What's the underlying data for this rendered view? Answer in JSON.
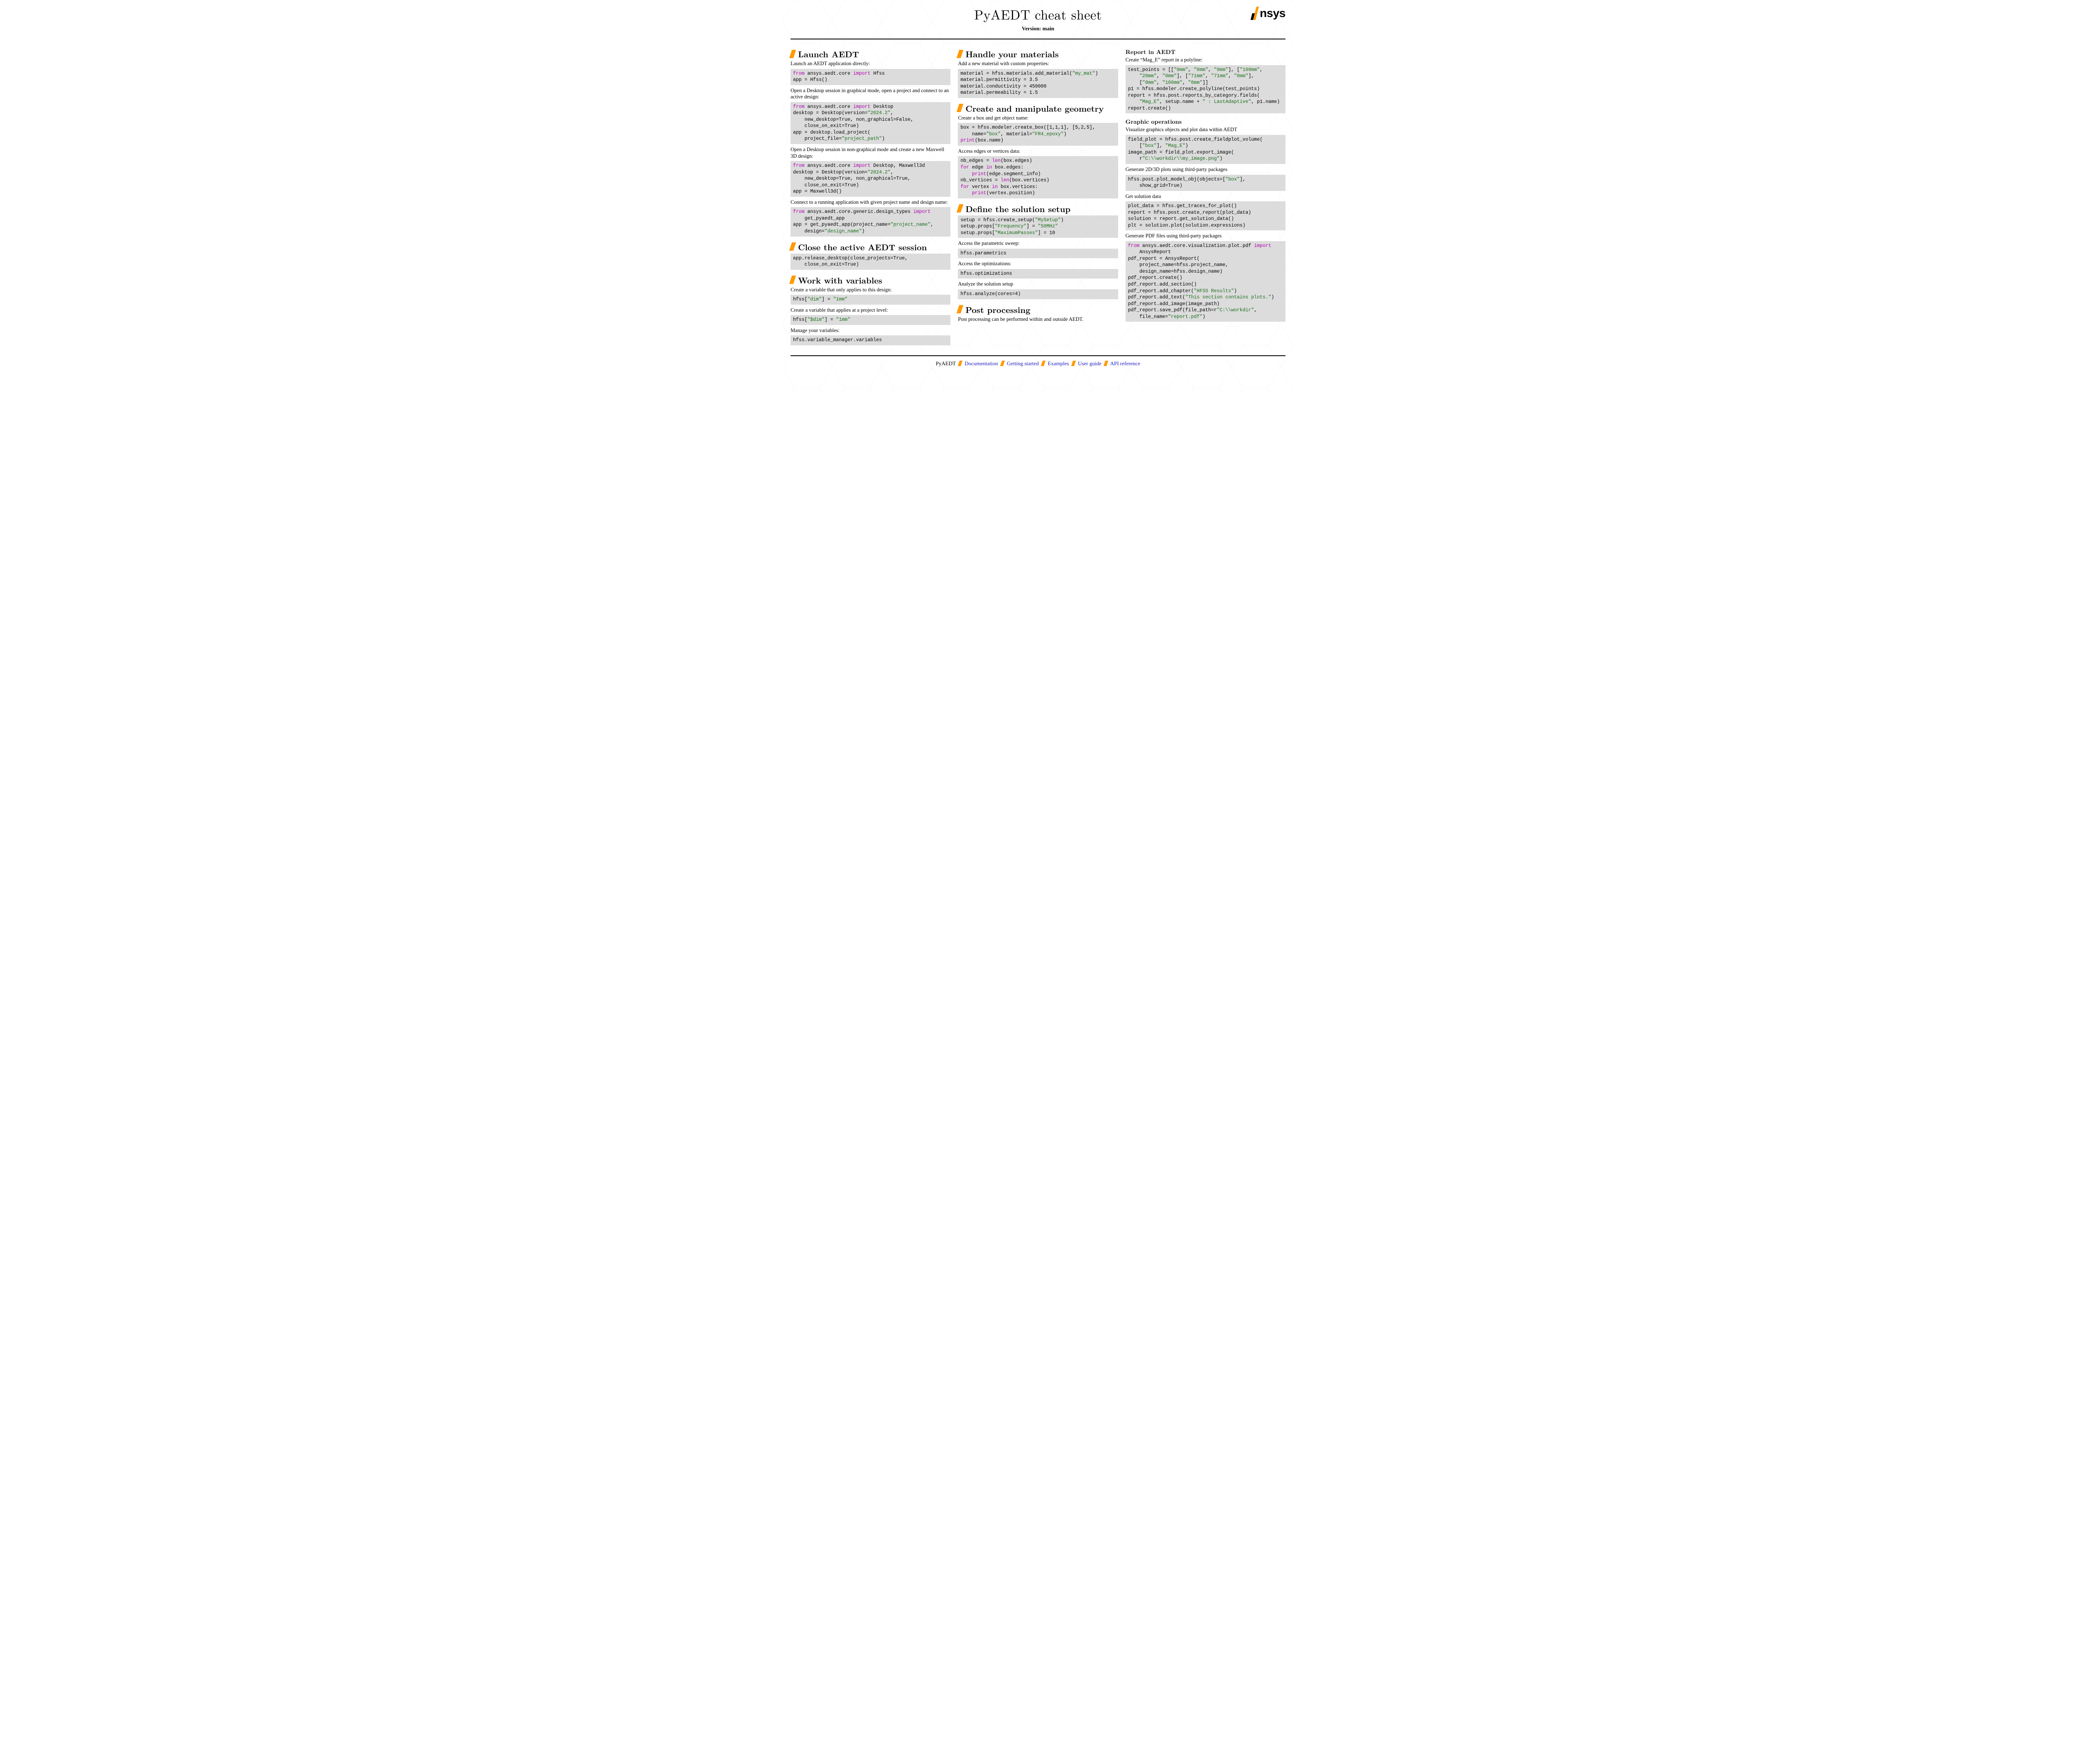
{
  "header": {
    "title": "PyAEDT cheat sheet",
    "version": "Version: main",
    "logo_text": "nsys"
  },
  "col1": {
    "s1": {
      "title": "Launch AEDT",
      "p1": "Launch an AEDT application directly:",
      "p2": "Open a Desktop session in graphical mode, open a project and connect to an active design:",
      "p3": "Open a Desktop session in non-graphical mode and create a new Maxwell 3D design:",
      "p4": "Connect to a running application with given project name and design name:"
    },
    "s2": {
      "title": "Close the active AEDT session"
    },
    "s3": {
      "title": "Work with variables",
      "p1": "Create a variable that only applies to this design:",
      "p2": "Create a variable that applies at a project level:",
      "p3": "Manage your variables:"
    }
  },
  "col2": {
    "s1": {
      "title": "Handle your materials",
      "p1": "Add a new material with custom properties:"
    },
    "s2": {
      "title": "Create and manipulate geometry",
      "p1": "Create a box and get object name:",
      "p2": "Access edges or vertices data:"
    },
    "s3": {
      "title": "Define the solution setup",
      "p1": "Access the parametric sweep:",
      "p2": "Access the optimizations:",
      "p3": "Analyze the solution setup"
    },
    "s4": {
      "title": "Post processing",
      "p1": "Post processing can be performed within and outside AEDT."
    }
  },
  "col3": {
    "s1": {
      "title": "Report in AEDT",
      "p1": "Create “Mag_E” report in a polyline:"
    },
    "s2": {
      "title": "Graphic operations",
      "p1": "Visualize graphics objects and plot data within AEDT",
      "p2": "Generate 2D/3D plots using third-party packages",
      "p3": "Get solution data",
      "p4": "Generate PDF files using third-party packages"
    }
  },
  "footer": {
    "brand": "PyAEDT",
    "links": [
      "Documentation",
      "Getting started",
      "Examples",
      "User guide",
      "API reference"
    ]
  },
  "code": {
    "launch1": [
      [
        "kw-import",
        "from"
      ],
      [
        "t",
        " ansys.aedt.core "
      ],
      [
        "kw-import",
        "import"
      ],
      [
        "t",
        " Hfss\napp = Hfss()"
      ]
    ],
    "launch2": [
      [
        "kw-import",
        "from"
      ],
      [
        "t",
        " ansys.aedt.core "
      ],
      [
        "kw-import",
        "import"
      ],
      [
        "t",
        " Desktop\ndesktop = Desktop(version="
      ],
      [
        "str",
        "\"2024.2\""
      ],
      [
        "t",
        ",\n    new_desktop=True, non_graphical=False,\n    close_on_exit=True)\napp = desktop.load_project(\n    project_file="
      ],
      [
        "str",
        "\"project_path\""
      ],
      [
        "t",
        ")"
      ]
    ],
    "launch3": [
      [
        "kw-import",
        "from"
      ],
      [
        "t",
        " ansys.aedt.core "
      ],
      [
        "kw-import",
        "import"
      ],
      [
        "t",
        " Desktop, Maxwell3d\ndesktop = Desktop(version="
      ],
      [
        "str",
        "\"2024.2\""
      ],
      [
        "t",
        ",\n    new_desktop=True, non_graphical=True,\n    close_on_exit=True)\napp = Maxwell3d()"
      ]
    ],
    "launch4": [
      [
        "kw-import",
        "from"
      ],
      [
        "t",
        " ansys.aedt.core.generic.design_types "
      ],
      [
        "kw-import",
        "import"
      ],
      [
        "t",
        "\n    get_pyaedt_app\napp = get_pyaedt_app(project_name="
      ],
      [
        "str",
        "\"project_name\""
      ],
      [
        "t",
        ",\n    design="
      ],
      [
        "str",
        "\"design_name\""
      ],
      [
        "t",
        ")"
      ]
    ],
    "close1": [
      [
        "t",
        "app.release_desktop(close_projects=True,\n    close_on_exit=True)"
      ]
    ],
    "var1": [
      [
        "t",
        "hfss["
      ],
      [
        "str",
        "\"dim\""
      ],
      [
        "t",
        "] = "
      ],
      [
        "str",
        "\"1mm\""
      ]
    ],
    "var2": [
      [
        "t",
        "hfss["
      ],
      [
        "str",
        "\"$dim\""
      ],
      [
        "t",
        "] = "
      ],
      [
        "str",
        "\"1mm\""
      ]
    ],
    "var3": [
      [
        "t",
        "hfss.variable_manager.variables"
      ]
    ],
    "mat1": [
      [
        "t",
        "material = hfss.materials.add_material("
      ],
      [
        "str",
        "\"my_mat\""
      ],
      [
        "t",
        ")\nmaterial.permittivity = 3.5\nmaterial.conductivity = 450000\nmaterial.permeability = 1.5"
      ]
    ],
    "geom1": [
      [
        "t",
        "box = hfss.modeler.create_box([1,1,1], [5,2,5],\n    name="
      ],
      [
        "str",
        "\"box\""
      ],
      [
        "t",
        ", material="
      ],
      [
        "str",
        "\"FR4_epoxy\""
      ],
      [
        "t",
        ")\n"
      ],
      [
        "kw-builtin",
        "print"
      ],
      [
        "t",
        "(box.name)"
      ]
    ],
    "geom2": [
      [
        "t",
        "nb_edges = "
      ],
      [
        "kw-builtin",
        "len"
      ],
      [
        "t",
        "(box.edges)\n"
      ],
      [
        "kw-flow",
        "for"
      ],
      [
        "t",
        " edge "
      ],
      [
        "kw-flow",
        "in"
      ],
      [
        "t",
        " box.edges:\n    "
      ],
      [
        "kw-builtin",
        "print"
      ],
      [
        "t",
        "(edge.segment_info)\nnb_vertices = "
      ],
      [
        "kw-builtin",
        "len"
      ],
      [
        "t",
        "(box.vertices)\n"
      ],
      [
        "kw-flow",
        "for"
      ],
      [
        "t",
        " vertex "
      ],
      [
        "kw-flow",
        "in"
      ],
      [
        "t",
        " box.vertices:\n    "
      ],
      [
        "kw-builtin",
        "print"
      ],
      [
        "t",
        "(vertex.position)"
      ]
    ],
    "setup1": [
      [
        "t",
        "setup = hfss.create_setup("
      ],
      [
        "str",
        "\"MySetup\""
      ],
      [
        "t",
        ")\nsetup.props["
      ],
      [
        "str",
        "\"Frequency\""
      ],
      [
        "t",
        "] = "
      ],
      [
        "str",
        "\"50MHz\""
      ],
      [
        "t",
        "\nsetup.props["
      ],
      [
        "str",
        "\"MaximumPasses\""
      ],
      [
        "t",
        "] = 10"
      ]
    ],
    "setup2": [
      [
        "t",
        "hfss.parametrics"
      ]
    ],
    "setup3": [
      [
        "t",
        "hfss.optimizations"
      ]
    ],
    "setup4": [
      [
        "t",
        "hfss.analyze(cores=4)"
      ]
    ],
    "report1": [
      [
        "t",
        "test_points = [["
      ],
      [
        "str",
        "\"0mm\""
      ],
      [
        "t",
        ", "
      ],
      [
        "str",
        "\"0mm\""
      ],
      [
        "t",
        ", "
      ],
      [
        "str",
        "\"0mm\""
      ],
      [
        "t",
        "], ["
      ],
      [
        "str",
        "\"100mm\""
      ],
      [
        "t",
        ",\n    "
      ],
      [
        "str",
        "\"20mm\""
      ],
      [
        "t",
        ", "
      ],
      [
        "str",
        "\"0mm\""
      ],
      [
        "t",
        "], ["
      ],
      [
        "str",
        "\"71mm\""
      ],
      [
        "t",
        ", "
      ],
      [
        "str",
        "\"71mm\""
      ],
      [
        "t",
        ", "
      ],
      [
        "str",
        "\"0mm\""
      ],
      [
        "t",
        "],\n    ["
      ],
      [
        "str",
        "\"0mm\""
      ],
      [
        "t",
        ", "
      ],
      [
        "str",
        "\"100mm\""
      ],
      [
        "t",
        ", "
      ],
      [
        "str",
        "\"0mm\""
      ],
      [
        "t",
        "]]\np1 = hfss.modeler.create_polyline(test_points)\nreport = hfss.post.reports_by_category.fields(\n    "
      ],
      [
        "str",
        "\"Mag_E\""
      ],
      [
        "t",
        ", setup.name + "
      ],
      [
        "str",
        "\" : LastAdaptive\""
      ],
      [
        "t",
        ", p1.name)\nreport.create()"
      ]
    ],
    "gfx1": [
      [
        "t",
        "field_plot = hfss.post.create_fieldplot_volume(\n    ["
      ],
      [
        "str",
        "\"box\""
      ],
      [
        "t",
        "], "
      ],
      [
        "str",
        "\"Mag_E\""
      ],
      [
        "t",
        ")\nimage_path = field_plot.export_image(\n    r"
      ],
      [
        "str",
        "\"C:\\\\workdir\\\\my_image.png\""
      ],
      [
        "t",
        ")"
      ]
    ],
    "gfx2": [
      [
        "t",
        "hfss.post.plot_model_obj(objects=["
      ],
      [
        "str",
        "\"box\""
      ],
      [
        "t",
        "],\n    show_grid=True)"
      ]
    ],
    "gfx3": [
      [
        "t",
        "plot_data = hfss.get_traces_for_plot()\nreport = hfss.post.create_report(plot_data)\nsolution = report.get_solution_data()\nplt = solution.plot(solution.expressions)"
      ]
    ],
    "gfx4": [
      [
        "kw-import",
        "from"
      ],
      [
        "t",
        " ansys.aedt.core.visualization.plot.pdf "
      ],
      [
        "kw-import",
        "import"
      ],
      [
        "t",
        "\n    AnsysReport\npdf_report = AnsysReport(\n    project_name=hfss.project_name,\n    design_name=hfss.design_name)\npdf_report.create()\npdf_report.add_section()\npdf_report.add_chapter("
      ],
      [
        "str",
        "\"HFSS Results\""
      ],
      [
        "t",
        ")\npdf_report.add_text("
      ],
      [
        "str",
        "\"This section contains plots.\""
      ],
      [
        "t",
        ")\npdf_report.add_image(image_path)\npdf_report.save_pdf(file_path=r"
      ],
      [
        "str",
        "\"C:\\\\workdir\""
      ],
      [
        "t",
        ",\n    file_name="
      ],
      [
        "str",
        "\"report.pdf\""
      ],
      [
        "t",
        ")"
      ]
    ]
  }
}
